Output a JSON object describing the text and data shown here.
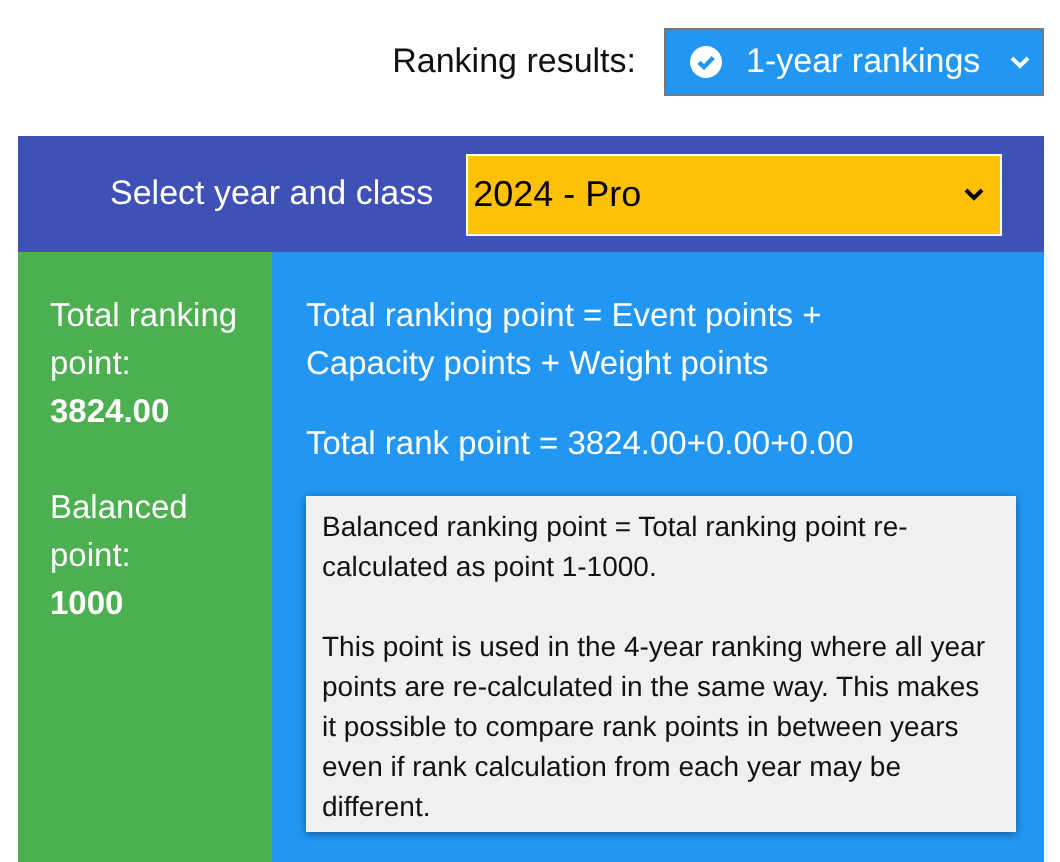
{
  "ranking_results": {
    "label": "Ranking results:",
    "value": "1-year rankings"
  },
  "selector": {
    "label": "Select year and class",
    "value": "2024 - Pro"
  },
  "summary": [
    {
      "label": "Total ranking point:",
      "value": "3824.00"
    },
    {
      "label": "Balanced point:",
      "value": "1000"
    }
  ],
  "formulas": [
    "Total ranking point = Event points + Capacity points + Weight points",
    "Total rank point = 3824.00+0.00+0.00"
  ],
  "note": [
    "Balanced ranking point = Total ranking point re-calculated as point 1-1000.",
    "This point is used in the 4-year ranking where all year points are re-calculated in the same way. This makes it possible to compare rank points in between years even if rank calculation from each year may be different."
  ]
}
